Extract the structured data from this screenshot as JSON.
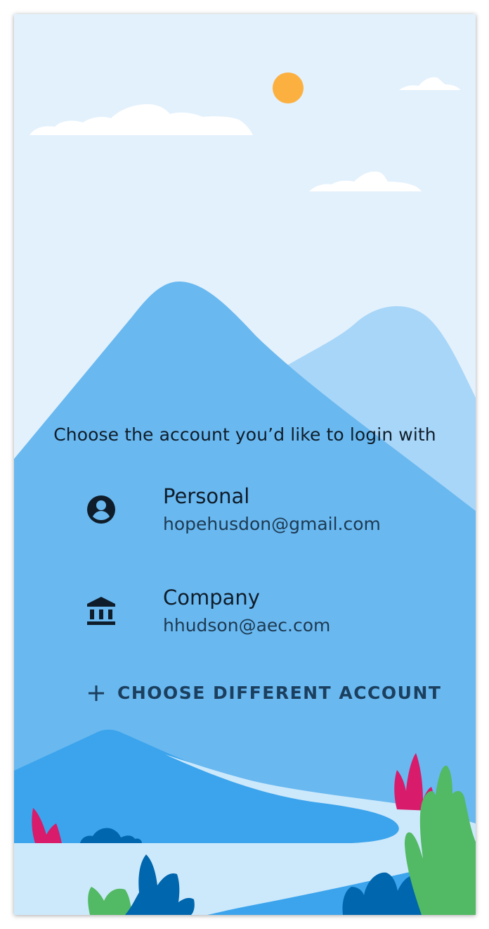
{
  "prompt": "Choose the account you’d like to login with",
  "accounts": [
    {
      "title": "Personal",
      "email": "hopehusdon@gmail.com",
      "icon": "account-circle-icon"
    },
    {
      "title": "Company",
      "email": "hhudson@aec.com",
      "icon": "bank-icon"
    }
  ],
  "choose_different": {
    "label": "CHOOSE DIFFERENT ACCOUNT",
    "icon": "plus-icon"
  },
  "colors": {
    "sky": "#e3f1fc",
    "sun": "#fbb040",
    "mountain_main": "#69b8f0",
    "mountain_back": "#a8d6f8",
    "hill_front": "#3ba4ec",
    "river": "#cce8fb",
    "plant_pink": "#d81b6a",
    "plant_green": "#52b964",
    "plant_dark_blue": "#0066ad"
  }
}
